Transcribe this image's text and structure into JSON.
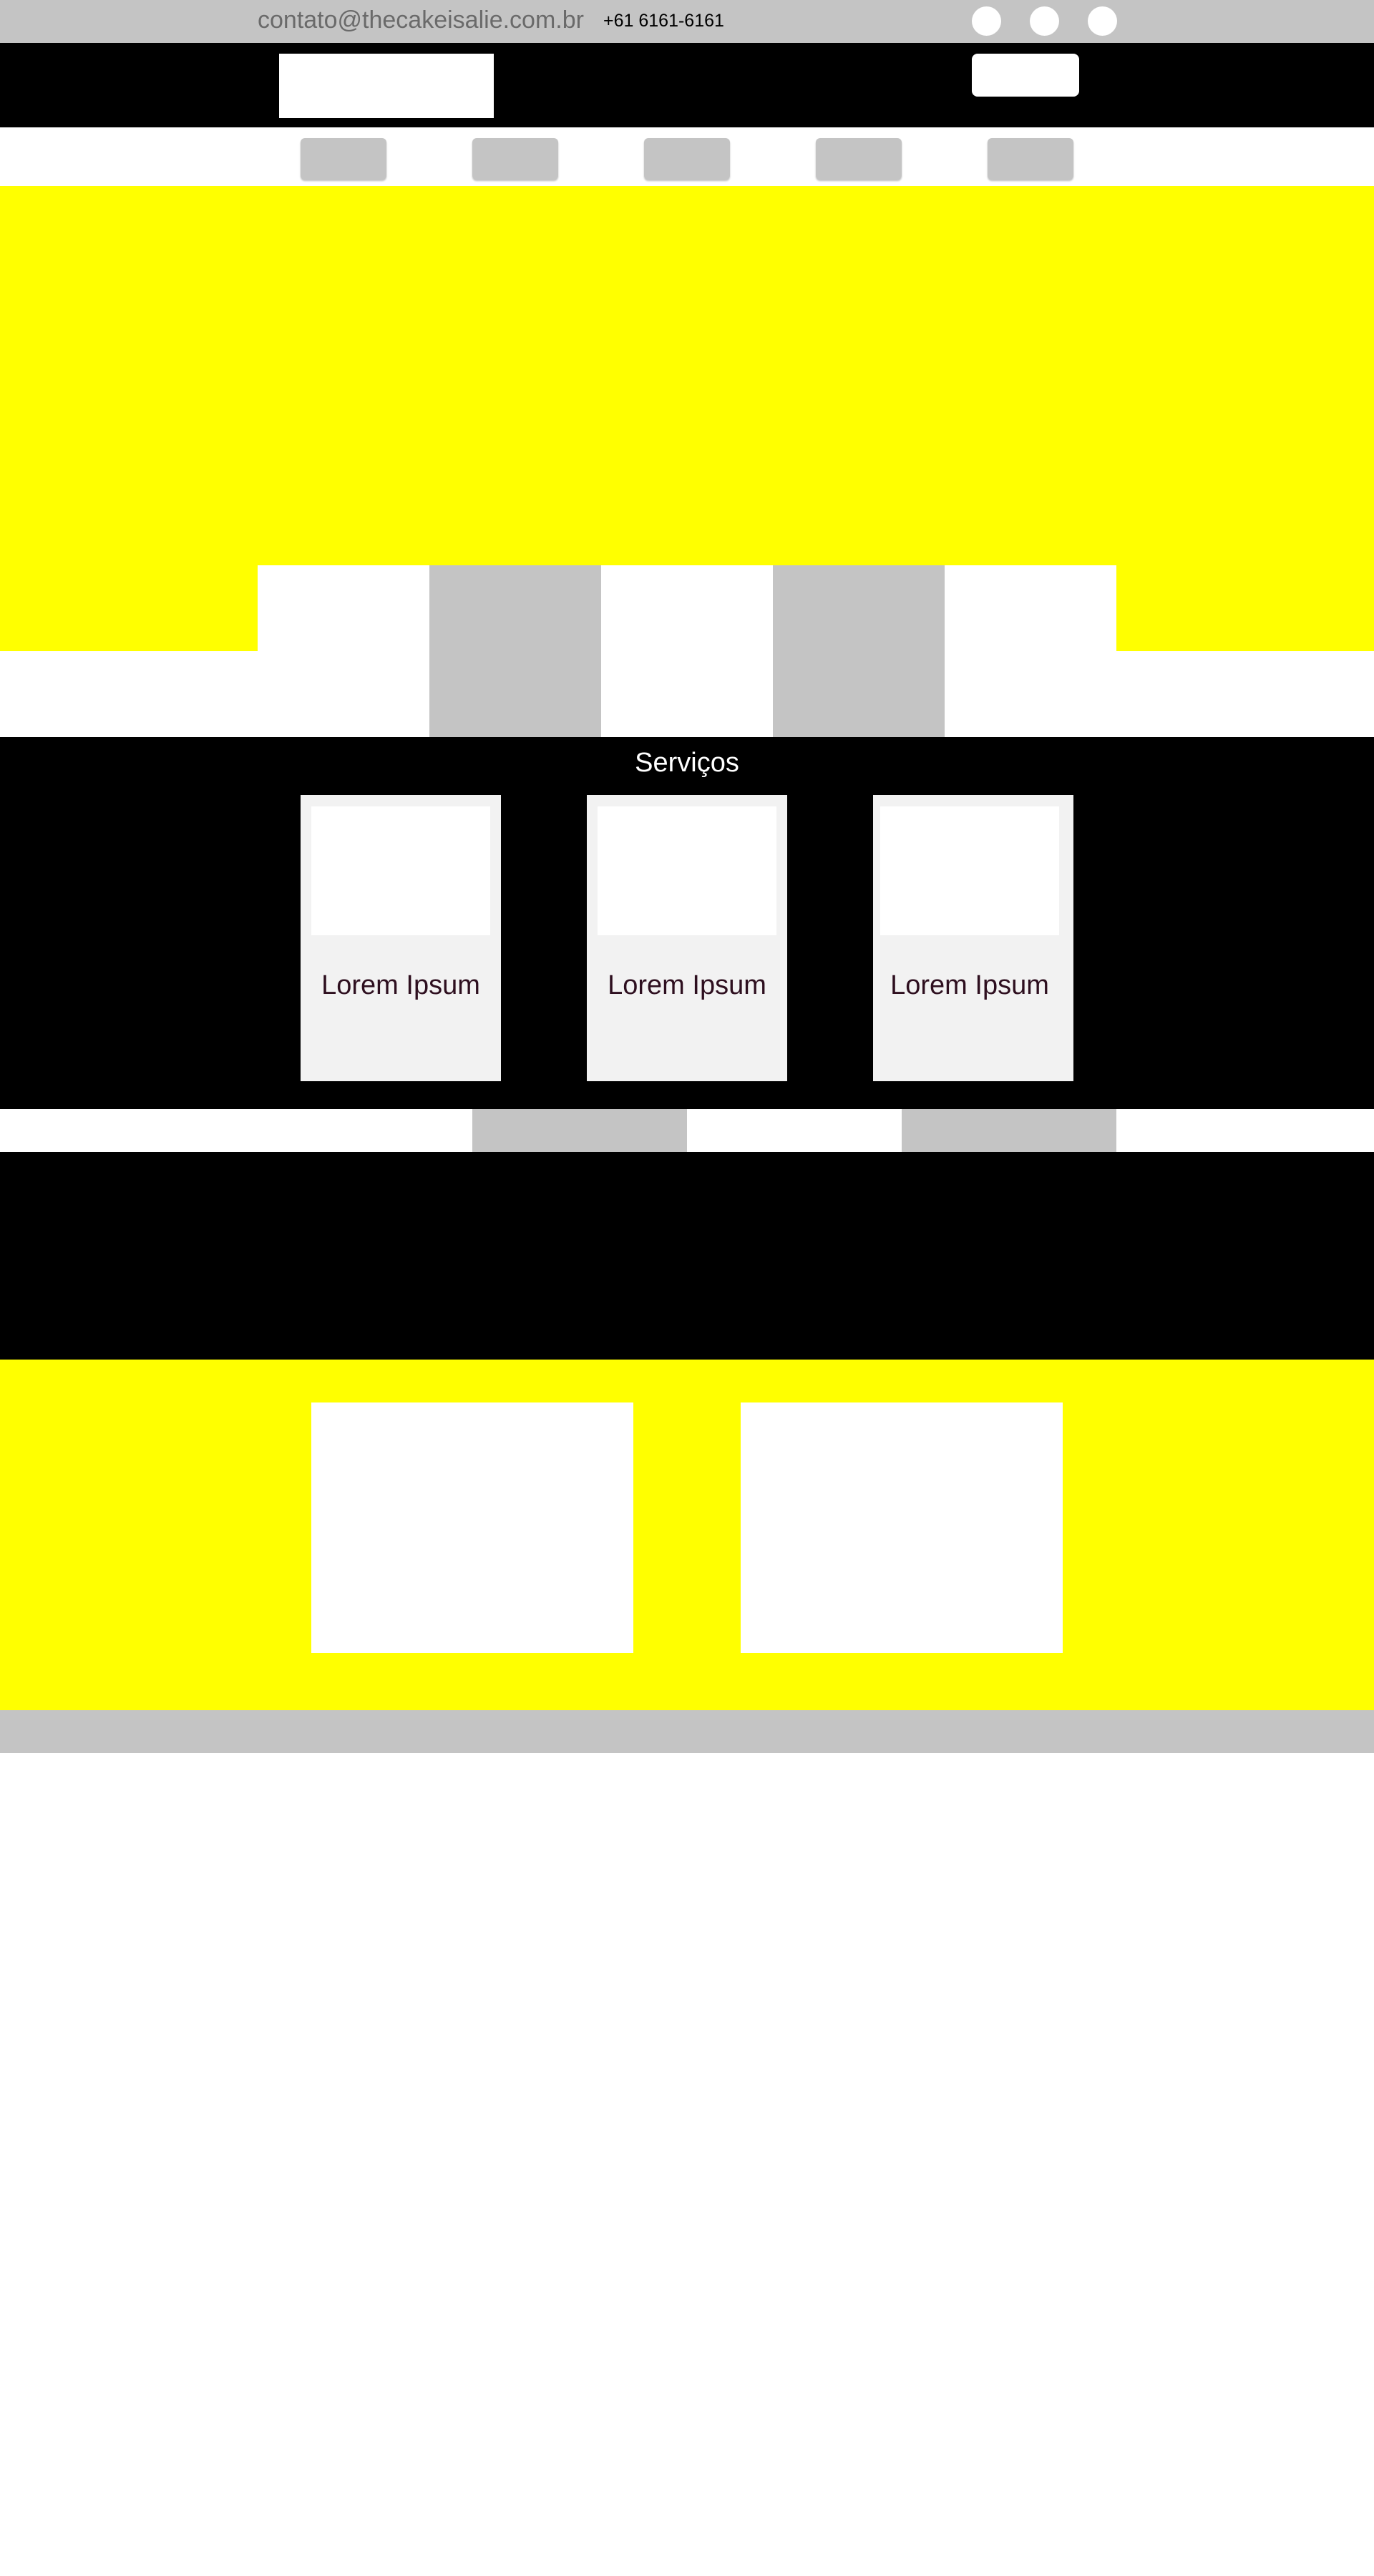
{
  "contact": {
    "email": "contato@thecakeisalie.com.br",
    "phone": "+61 6161-6161"
  },
  "services": {
    "title": "Serviços",
    "cards": [
      {
        "label": "Lorem Ipsum"
      },
      {
        "label": "Lorem Ipsum"
      },
      {
        "label": "Lorem Ipsum"
      }
    ]
  },
  "colors": {
    "accent_yellow": "#ffff00",
    "placeholder_grey": "#c4c4c4",
    "dark": "#000000",
    "card_bg": "#f2f2f2",
    "card_text": "#2e0f1f"
  }
}
